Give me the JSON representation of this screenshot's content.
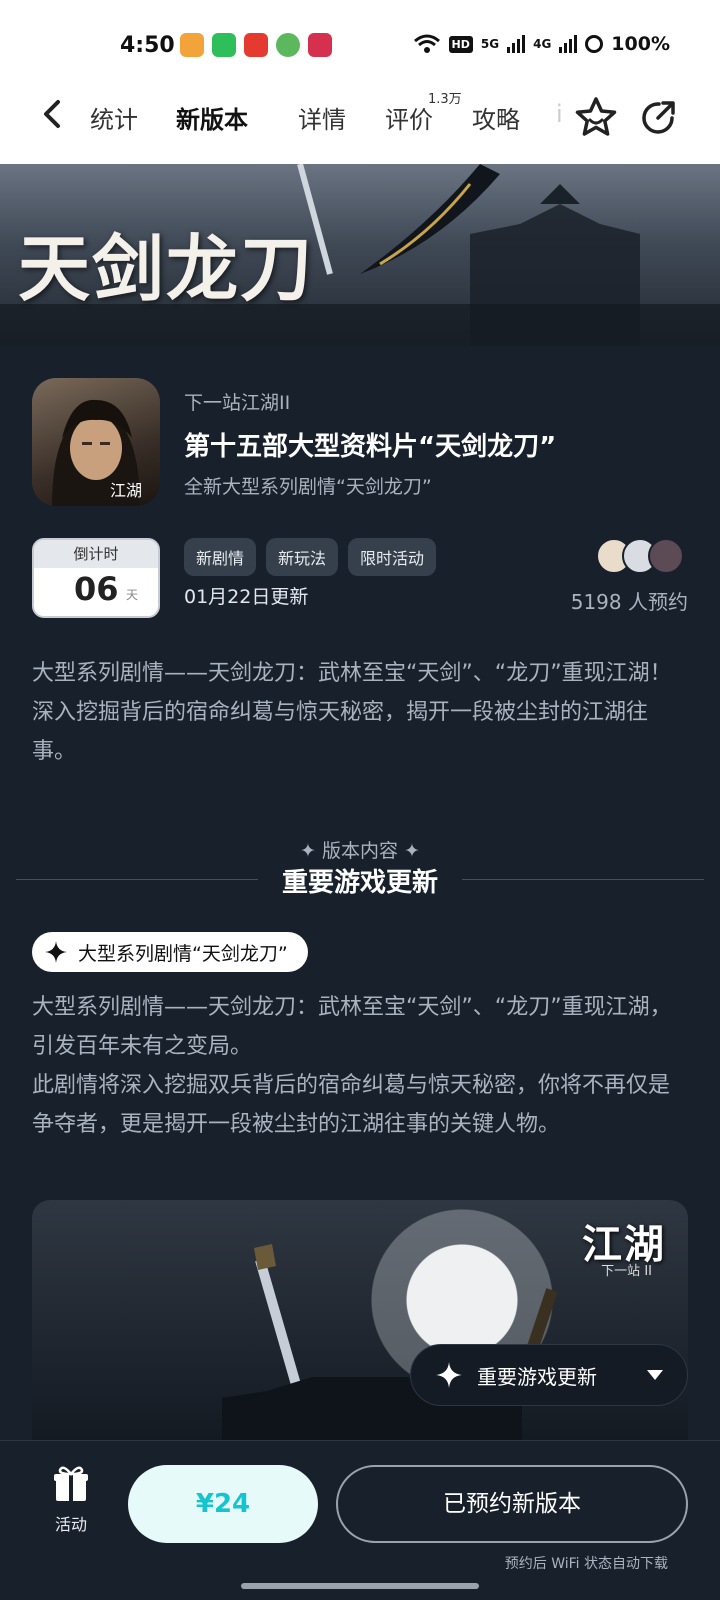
{
  "status_bar": {
    "time": "4:50",
    "hd": "HD",
    "net1": "5G",
    "net2": "4G",
    "battery": "100%"
  },
  "nav": {
    "tabs": [
      {
        "label": "统计",
        "active": false
      },
      {
        "label": "新版本",
        "active": true
      },
      {
        "label": "详情",
        "active": false
      },
      {
        "label": "评价",
        "active": false
      },
      {
        "label": "攻略",
        "active": false
      }
    ],
    "review_count": "1.3万",
    "overflow_tab_glimpse": "i"
  },
  "banner": {
    "title": "天剑龙刀"
  },
  "game": {
    "name": "下一站江湖II",
    "headline": "第十五部大型资料片“天剑龙刀”",
    "description": "全新大型系列剧情“天剑龙刀”"
  },
  "countdown": {
    "label": "倒计时",
    "value": "06",
    "unit": "天"
  },
  "tags": [
    "新剧情",
    "新玩法",
    "限时活动"
  ],
  "update_date": "01月22日更新",
  "reservation": {
    "count_text": "5198 人预约"
  },
  "intro": "大型系列剧情——天剑龙刀：武林至宝“天剑”、“龙刀”重现江湖！深入挖掘背后的宿命纠葛与惊天秘密，揭开一段被尘封的江湖往事。",
  "section": {
    "kicker": "✦ 版本内容 ✦",
    "title": "重要游戏更新",
    "item_tag": "大型系列剧情“天剑龙刀”",
    "body_line1": "大型系列剧情——天剑龙刀：武林至宝“天剑”、“龙刀”重现江湖，引发百年未有之变局。",
    "body_line2": "此剧情将深入挖掘双兵背后的宿命纠葛与惊天秘密，你将不再仅是争夺者，更是揭开一段被尘封的江湖往事的关键人物。"
  },
  "poster": {
    "logo": "江湖",
    "logo_sub": "下一站",
    "logo_mark": "II"
  },
  "floating_menu": {
    "label": "重要游戏更新"
  },
  "bottom_bar": {
    "gift_label": "活动",
    "price_label": "¥24",
    "reserved_label": "已预约新版本",
    "hint": "预约后 WiFi 状态自动下载"
  },
  "colors": {
    "accent": "#15c5ce",
    "background": "#18202b",
    "muted_text": "#a9b2bf"
  },
  "icons": [
    "back-arrow-icon",
    "star-face-icon",
    "share-icon",
    "sparkle-icon",
    "chevron-down-icon",
    "gift-icon"
  ]
}
